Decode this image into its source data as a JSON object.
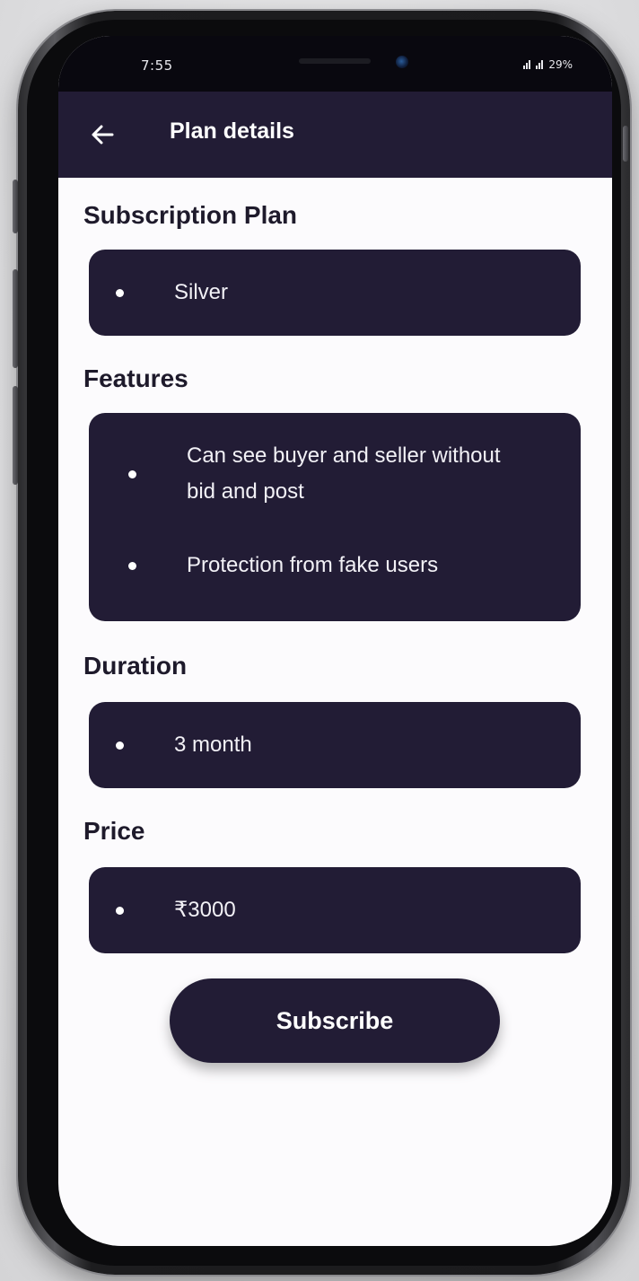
{
  "status_bar": {
    "time": "7:55",
    "battery": "29%"
  },
  "app_bar": {
    "title": "Plan details",
    "back_icon": "arrow-left-icon"
  },
  "sections": {
    "plan": {
      "title": "Subscription Plan",
      "items": [
        "Silver"
      ]
    },
    "features": {
      "title": "Features",
      "items": [
        "Can see buyer and seller without bid and post",
        "Protection from fake users"
      ]
    },
    "duration": {
      "title": "Duration",
      "items": [
        "3 month"
      ]
    },
    "price": {
      "title": "Price",
      "items": [
        "₹3000"
      ]
    }
  },
  "subscribe_label": "Subscribe",
  "colors": {
    "primary": "#221c35",
    "background": "#fcfbfd",
    "heading": "#1e1a2b"
  }
}
